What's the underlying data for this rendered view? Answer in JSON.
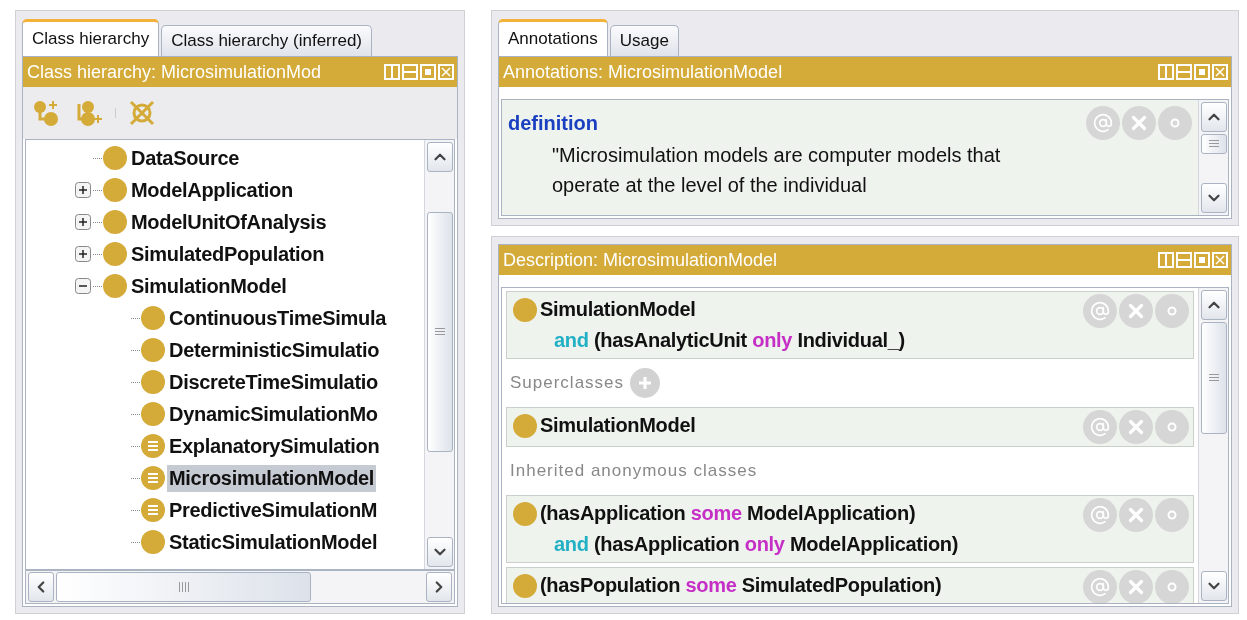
{
  "class_panel": {
    "tabs": [
      {
        "label": "Class hierarchy",
        "selected": true
      },
      {
        "label": "Class hierarchy (inferred)",
        "selected": false
      }
    ],
    "title": "Class hierarchy: MicrosimulationMod",
    "tree": [
      {
        "label": "DataSource",
        "kind": "class",
        "selected": false
      },
      {
        "label": "ModelApplication",
        "kind": "class",
        "expanded": false,
        "selected": false
      },
      {
        "label": "ModelUnitOfAnalysis",
        "kind": "class",
        "expanded": false,
        "selected": false
      },
      {
        "label": "SimulatedPopulation",
        "kind": "class",
        "expanded": false,
        "selected": false
      },
      {
        "label": "SimulationModel",
        "kind": "class",
        "expanded": true,
        "selected": false,
        "children": [
          {
            "label": "ContinuousTimeSimula",
            "kind": "class",
            "selected": false
          },
          {
            "label": "DeterministicSimulatio",
            "kind": "class",
            "selected": false
          },
          {
            "label": "DiscreteTimeSimulatio",
            "kind": "class",
            "selected": false
          },
          {
            "label": "DynamicSimulationMo",
            "kind": "class",
            "selected": false
          },
          {
            "label": "ExplanatorySimulation",
            "kind": "defined",
            "selected": false
          },
          {
            "label": "MicrosimulationModel",
            "kind": "defined",
            "selected": true
          },
          {
            "label": "PredictiveSimulationM",
            "kind": "defined",
            "selected": false
          },
          {
            "label": "StaticSimulationModel",
            "kind": "class",
            "selected": false
          }
        ]
      }
    ]
  },
  "annotations_panel": {
    "tabs": [
      {
        "label": "Annotations",
        "selected": true
      },
      {
        "label": "Usage",
        "selected": false
      }
    ],
    "title": "Annotations: MicrosimulationModel",
    "annotation": {
      "property": "definition",
      "value": "\"Microsimulation models are computer models that operate at the level of the individual"
    }
  },
  "description_panel": {
    "title": "Description: MicrosimulationModel",
    "items": [
      {
        "kind": "frame",
        "lines": [
          [
            {
              "text": "SimulationModel",
              "kind": "plain"
            }
          ],
          [
            {
              "text": "and",
              "kind": "keyword"
            },
            {
              "text": "(hasAnalyticUnit",
              "kind": "plain"
            },
            {
              "text": "only",
              "kind": "restriction"
            },
            {
              "text": "Individual_)",
              "kind": "plain"
            }
          ]
        ]
      },
      {
        "kind": "section",
        "label": "Superclasses",
        "addable": true
      },
      {
        "kind": "frame",
        "lines": [
          [
            {
              "text": "SimulationModel",
              "kind": "plain"
            }
          ]
        ]
      },
      {
        "kind": "section",
        "label": "Inherited anonymous classes",
        "addable": false
      },
      {
        "kind": "frame",
        "lines": [
          [
            {
              "text": "(hasApplication",
              "kind": "plain"
            },
            {
              "text": "some",
              "kind": "restriction"
            },
            {
              "text": "ModelApplication)",
              "kind": "plain"
            }
          ],
          [
            {
              "text": "and",
              "kind": "keyword"
            },
            {
              "text": "(hasApplication",
              "kind": "plain"
            },
            {
              "text": "only",
              "kind": "restriction"
            },
            {
              "text": "ModelApplication)",
              "kind": "plain"
            }
          ]
        ]
      },
      {
        "kind": "frame",
        "lines": [
          [
            {
              "text": "(hasPopulation",
              "kind": "plain"
            },
            {
              "text": "some",
              "kind": "restriction"
            },
            {
              "text": "SimulatedPopulation)",
              "kind": "plain"
            }
          ]
        ]
      }
    ]
  }
}
